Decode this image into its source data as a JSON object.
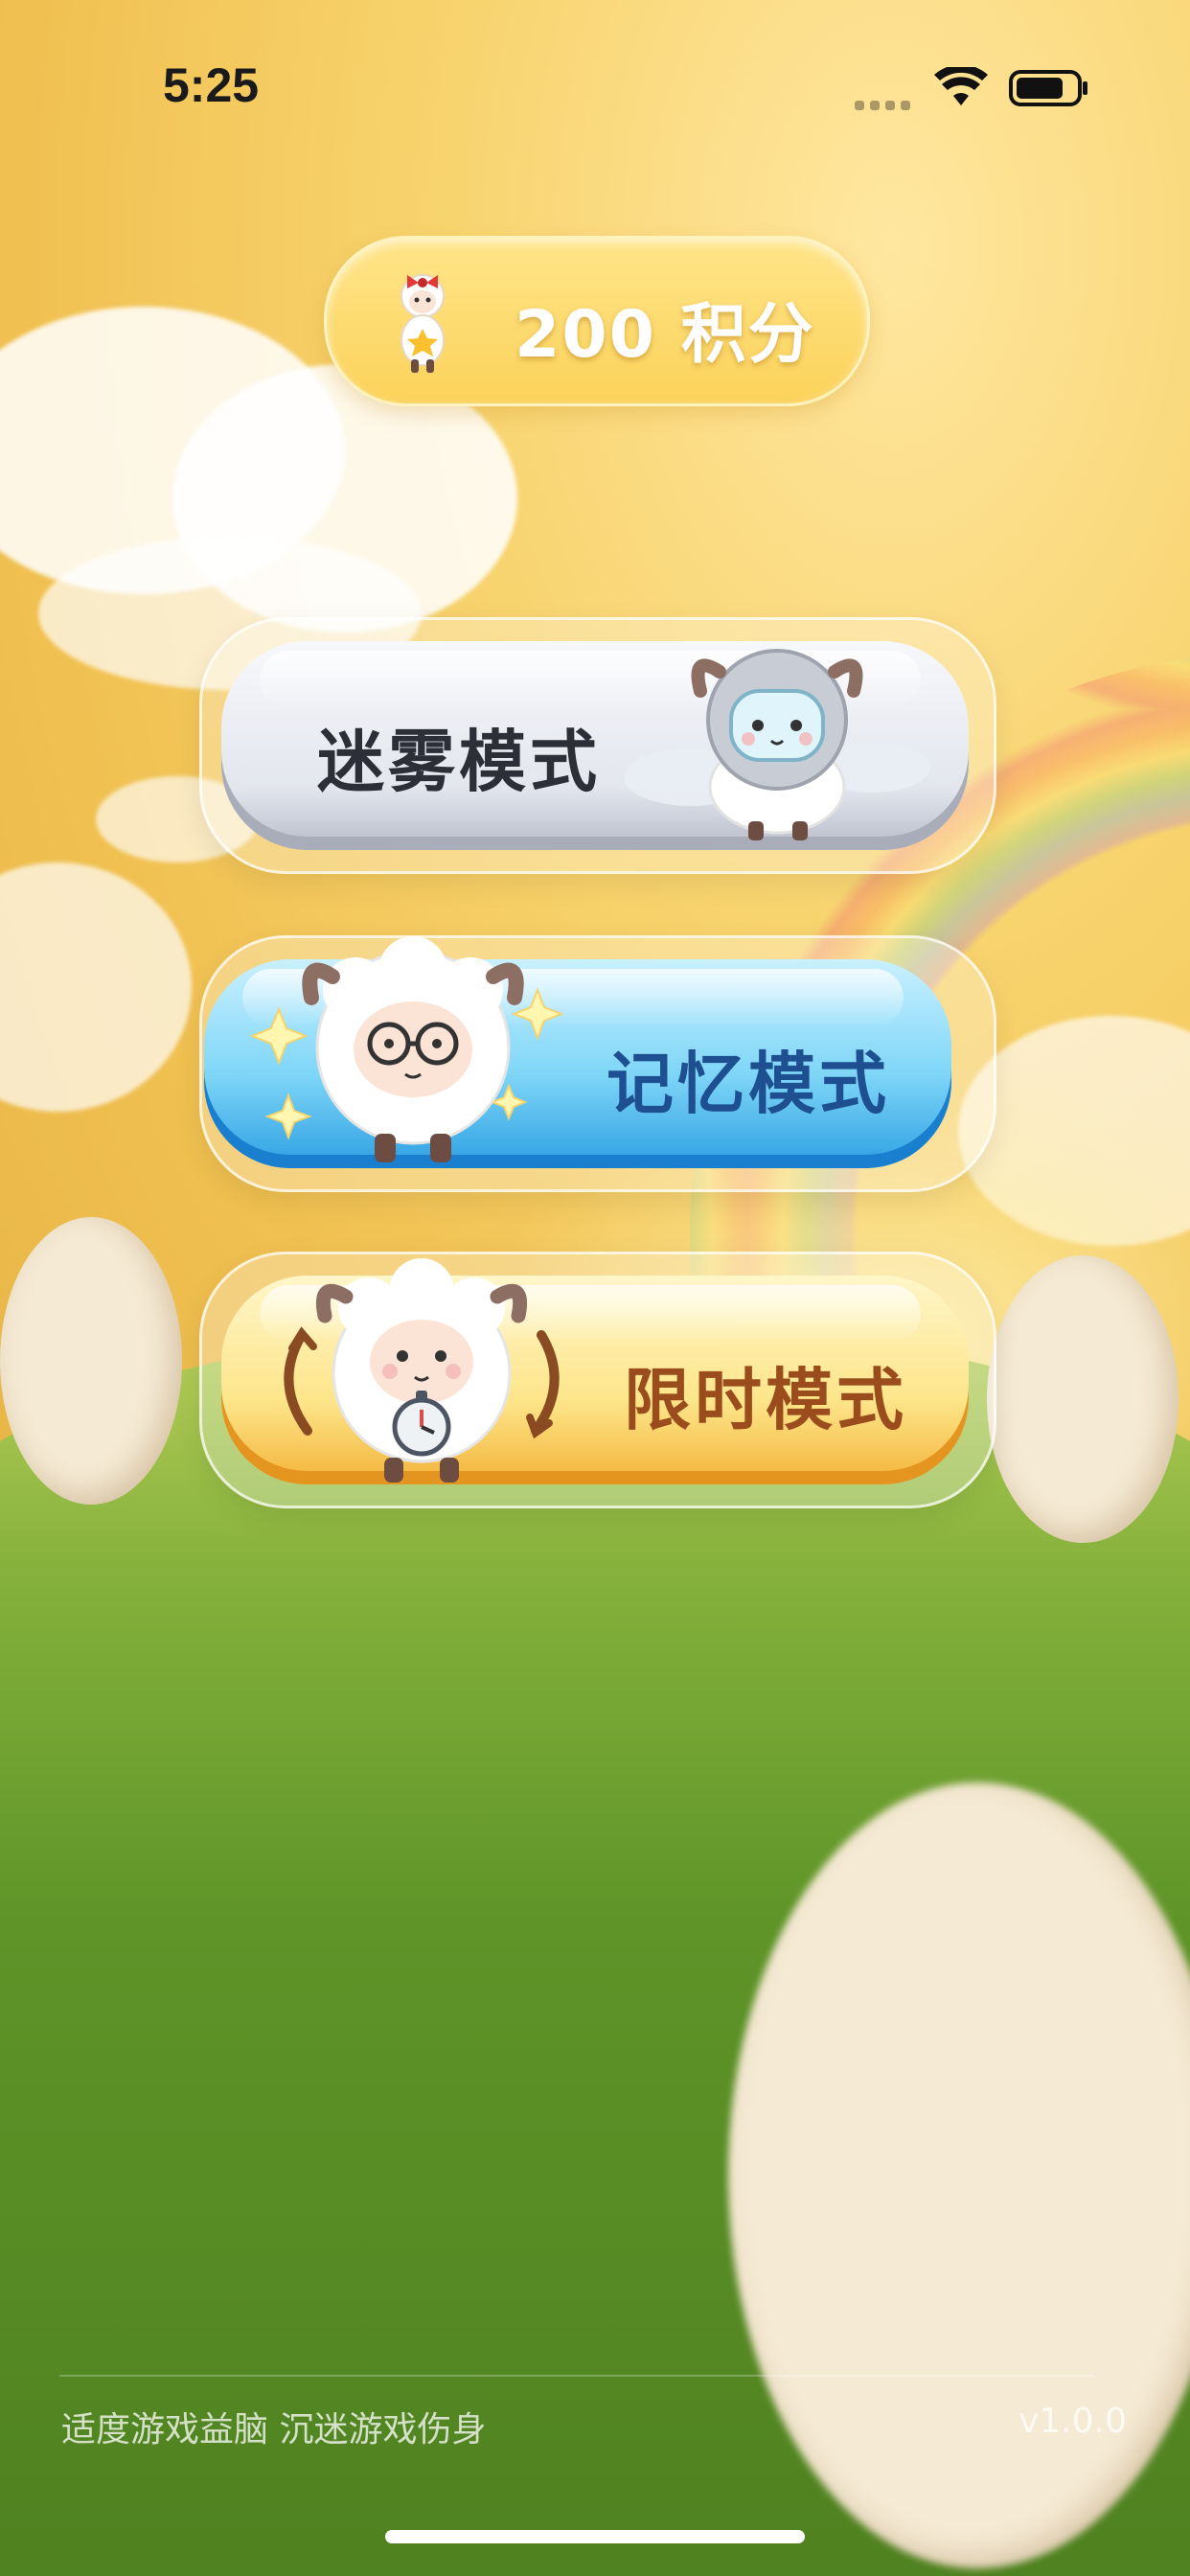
{
  "status_bar": {
    "time": "5:25"
  },
  "points": {
    "label": "200 积分",
    "icon": "sheep-mascot-icon"
  },
  "modes": [
    {
      "label": "迷雾模式",
      "icon": "astronaut-sheep-icon",
      "color": "#e3e6ee"
    },
    {
      "label": "记忆模式",
      "icon": "glasses-sheep-icon",
      "color": "#7fd6f7"
    },
    {
      "label": "限时模式",
      "icon": "stopwatch-sheep-icon",
      "color": "#fde58a"
    }
  ],
  "footer": {
    "notice": "适度游戏益脑 沉迷游戏伤身",
    "version": "v1.0.0"
  }
}
